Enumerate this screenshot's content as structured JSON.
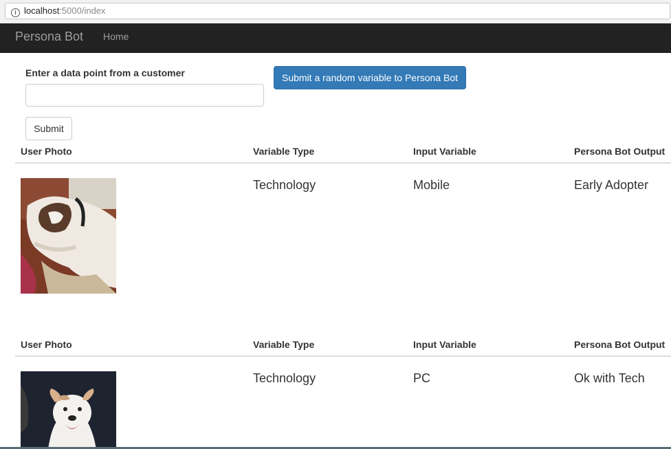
{
  "browser": {
    "url_host": "localhost",
    "url_path": ":5000/index"
  },
  "navbar": {
    "brand": "Persona Bot",
    "home": "Home"
  },
  "form": {
    "label": "Enter a data point from a customer",
    "input_value": "",
    "submit_label": "Submit",
    "random_button_label": "Submit a random variable to Persona Bot"
  },
  "tables": [
    {
      "headers": [
        "User Photo",
        "Variable Type",
        "Input Variable",
        "Persona Bot Output"
      ],
      "row": {
        "photo": "dog-photo-sleeping",
        "variable_type": "Technology",
        "input_variable": "Mobile",
        "output": "Early Adopter"
      }
    },
    {
      "headers": [
        "User Photo",
        "Variable Type",
        "Input Variable",
        "Persona Bot Output"
      ],
      "row": {
        "photo": "dog-photo-smiling",
        "variable_type": "Technology",
        "input_variable": "PC",
        "output": "Ok with Tech"
      }
    }
  ]
}
